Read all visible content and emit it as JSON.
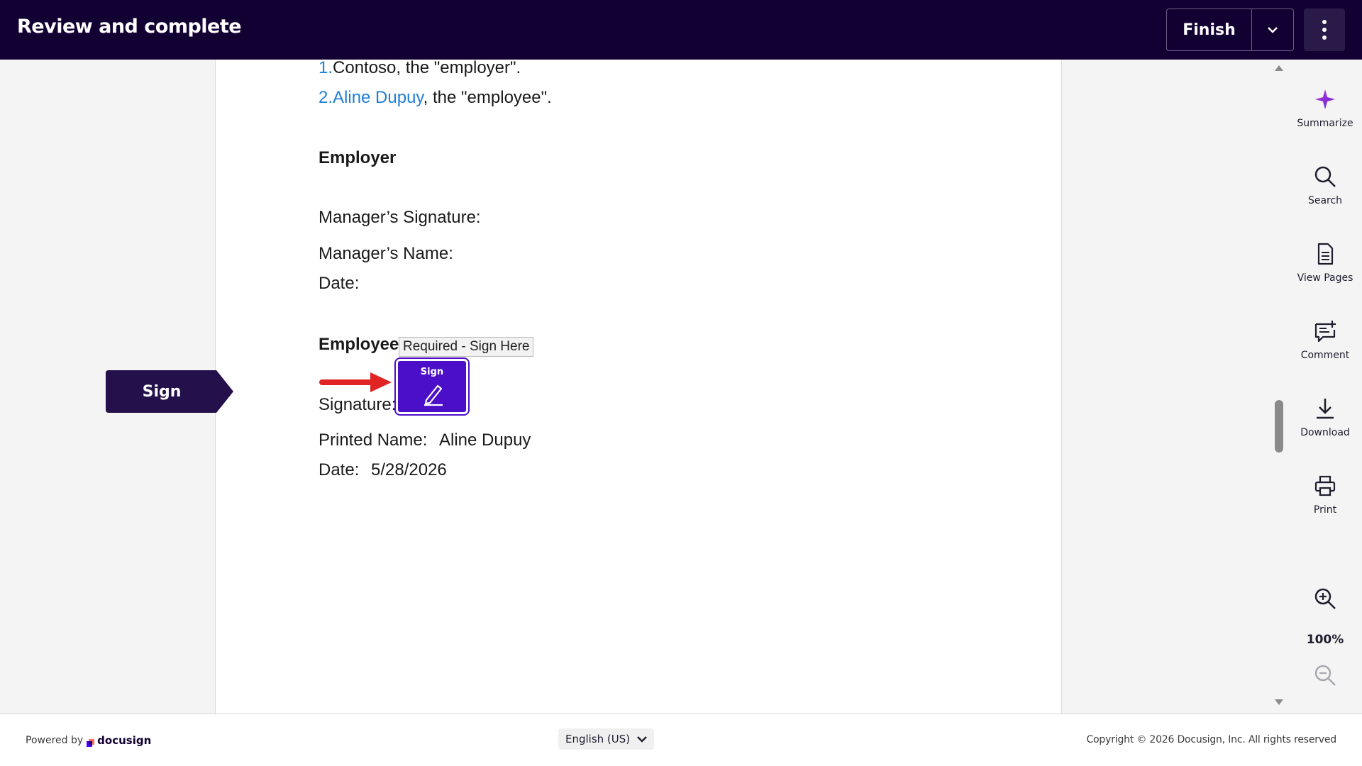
{
  "header": {
    "title": "Review and complete",
    "finish_label": "Finish",
    "bg_color": "#130032"
  },
  "document": {
    "parties": [
      {
        "number": "1.",
        "name": "Contoso",
        "suffix": ", the \"employer\"."
      },
      {
        "number": "2.",
        "name": "Aline Dupuy",
        "suffix": ", the \"employee\"."
      }
    ],
    "employer_heading": "Employer",
    "manager_signature_label": "Manager’s Signature:",
    "manager_name_label": "Manager’s Name:",
    "employer_date_label": "Date:",
    "employee_heading": "Employee",
    "signature_label": "Signature:",
    "printed_name_label": "Printed Name:",
    "printed_name_value": "Aline Dupuy",
    "employee_date_label": "Date:",
    "employee_date_value": "5/28/2026"
  },
  "sign_flag": {
    "label": "Sign",
    "color": "#24104a"
  },
  "sign_field": {
    "tooltip": "Required - Sign Here",
    "label": "Sign",
    "color": "#4b0fc9"
  },
  "toolbar": {
    "items": [
      {
        "label": "Summarize",
        "icon": "sparkle-icon"
      },
      {
        "label": "Search",
        "icon": "search-icon"
      },
      {
        "label": "View Pages",
        "icon": "document-icon"
      },
      {
        "label": "Comment",
        "icon": "comment-add-icon"
      },
      {
        "label": "Download",
        "icon": "download-icon"
      },
      {
        "label": "Print",
        "icon": "printer-icon"
      }
    ],
    "zoom_level": "100%"
  },
  "footer": {
    "powered_by": "Powered by",
    "brand": "docusign",
    "language": "English (US)",
    "copyright": "Copyright © 2026 Docusign, Inc. All rights reserved"
  }
}
